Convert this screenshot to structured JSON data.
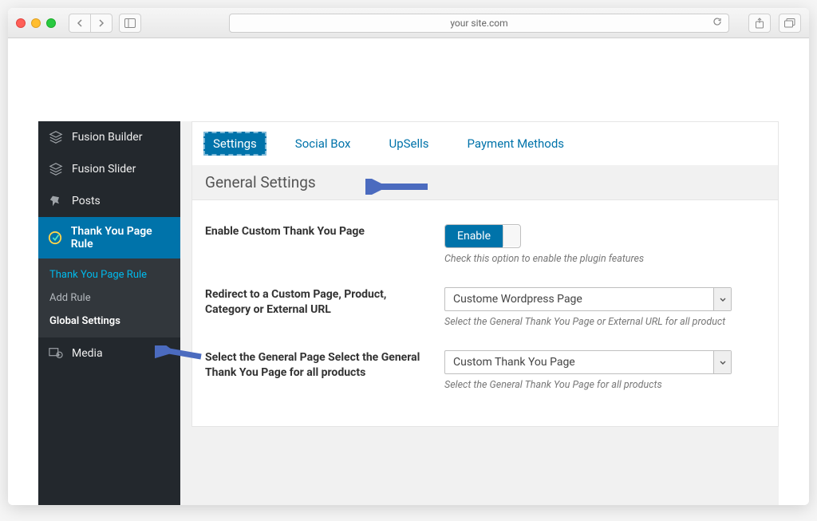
{
  "browser": {
    "url": "your site.com"
  },
  "sidebar": {
    "items": [
      {
        "label": "Fusion Builder",
        "icon": "layers"
      },
      {
        "label": "Fusion Slider",
        "icon": "layers"
      },
      {
        "label": "Posts",
        "icon": "pin"
      },
      {
        "label": "Thank You Page Rule",
        "icon": "circle-arrow",
        "active": true
      },
      {
        "label": "Media",
        "icon": "media"
      }
    ],
    "submenu": {
      "items": [
        {
          "label": "Thank You Page Rule",
          "highlight": true
        },
        {
          "label": "Add Rule"
        },
        {
          "label": "Global Settings",
          "current": true
        }
      ]
    }
  },
  "tabs": [
    {
      "label": "Settings",
      "active": true
    },
    {
      "label": "Social Box"
    },
    {
      "label": "UpSells"
    },
    {
      "label": "Payment Methods"
    }
  ],
  "section": {
    "title": "General Settings"
  },
  "settings": [
    {
      "label": "Enable Custom Thank You Page",
      "type": "toggle",
      "toggle_text": "Enable",
      "help": "Check this option to enable the plugin features"
    },
    {
      "label": "Redirect to a Custom Page, Product, Category or External URL",
      "type": "select",
      "value": "Custome Wordpress Page",
      "help": "Select the General Thank You Page or External URL for all product"
    },
    {
      "label": "Select the General Page Select the General Thank You Page for all products",
      "type": "select",
      "value": "Custom Thank You Page",
      "help": "Select the General Thank You Page for all products"
    }
  ]
}
